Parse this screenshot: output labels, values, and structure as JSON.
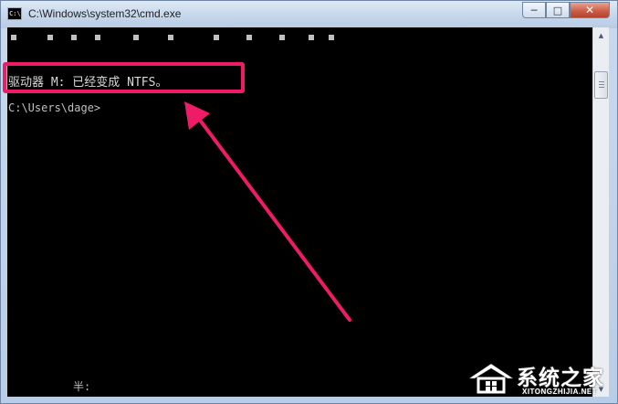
{
  "window": {
    "title": "C:\\Windows\\system32\\cmd.exe",
    "app_icon_text": "C:\\",
    "buttons": {
      "minimize": "─",
      "maximize": "□",
      "close": "✕"
    }
  },
  "console": {
    "lines": [
      "驱动器 M: 已经变成 NTFS。",
      "C:\\Users\\dage>"
    ],
    "ime_status": "半:"
  },
  "scrollbar": {
    "up_arrow": "▲",
    "down_arrow": "▼"
  },
  "annotation": {
    "highlight_color": "#ee1b66",
    "arrow_color": "#ee1b66"
  },
  "watermark": {
    "brand": "系统之家",
    "url": "XITONGZHIJIA.NET"
  }
}
